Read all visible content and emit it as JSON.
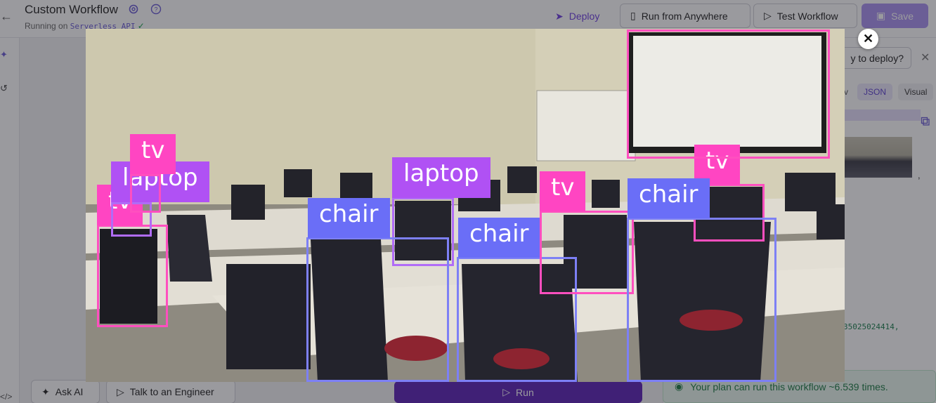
{
  "app": {
    "title": "Custom Workflow",
    "running_prefix": "Running on",
    "running_target": "Serverless API",
    "deploy_label": "Deploy",
    "run_anywhere_label": "Run from Anywhere",
    "test_workflow_label": "Test Workflow",
    "save_label": "Save",
    "ask_ai_label": "Ask AI",
    "talk_engineer_label": "Talk to an Engineer",
    "run_label": "Run",
    "ready_deploy_label": "y to deploy?",
    "tabs": [
      "v",
      "JSON",
      "Visual"
    ],
    "json_number_fragment": "35025024414,",
    "plan_message": "Your plan can run this workflow ~6.539 times."
  },
  "modal": {
    "close_icon": "close-icon",
    "detections": [
      {
        "label": "tv",
        "color": "pink"
      },
      {
        "label": "laptop",
        "color": "purple"
      },
      {
        "label": "tv",
        "color": "pink"
      },
      {
        "label": "laptop",
        "color": "purple"
      },
      {
        "label": "chair",
        "color": "blue"
      },
      {
        "label": "chair",
        "color": "blue"
      },
      {
        "label": "tv",
        "color": "pink"
      },
      {
        "label": "tv",
        "color": "pink"
      },
      {
        "label": "chair",
        "color": "blue"
      }
    ]
  },
  "colors": {
    "pink": "#ff45c2",
    "purple": "#b051f4",
    "blue": "#6a6ef7",
    "accent": "#5b21b6"
  }
}
